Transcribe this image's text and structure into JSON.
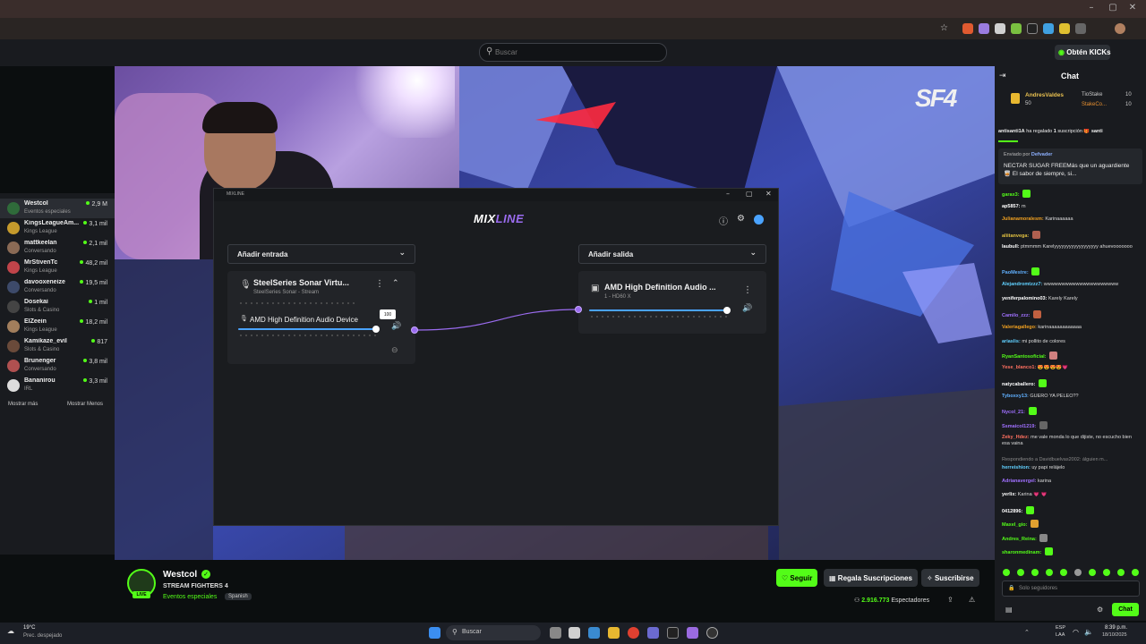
{
  "browser": {
    "window_controls": [
      "–",
      "▢",
      "✕"
    ]
  },
  "site_header": {
    "search_placeholder": "Buscar",
    "kicks_button_prefix": "Obtén",
    "kicks_button_brand": "KICKs"
  },
  "sidebar": {
    "items": [
      {
        "name": "Westcol",
        "category": "Eventos especiales",
        "viewers": "2,9 M",
        "color": "#2f6b3a"
      },
      {
        "name": "KingsLeagueAm...",
        "category": "Kings League",
        "viewers": "3,1 mil",
        "color": "#c59a2c"
      },
      {
        "name": "mattkeelan",
        "category": "Conversando",
        "viewers": "2,1 mil",
        "color": "#8a6a55"
      },
      {
        "name": "MrStivenTc",
        "category": "Kings League",
        "viewers": "48,2 mil",
        "color": "#c0444a"
      },
      {
        "name": "davooxeneize",
        "category": "Conversando",
        "viewers": "19,5 mil",
        "color": "#3d4a6a"
      },
      {
        "name": "Dosekai",
        "category": "Slots & Casino",
        "viewers": "1 mil",
        "color": "#444"
      },
      {
        "name": "ElZeein",
        "category": "Kings League",
        "viewers": "18,2 mil",
        "color": "#a27e5c"
      },
      {
        "name": "Kamikaze_evil",
        "category": "Slots & Casino",
        "viewers": "817",
        "color": "#6a4a3a"
      },
      {
        "name": "Brunenger",
        "category": "Conversando",
        "viewers": "3,8 mil",
        "color": "#b05050"
      },
      {
        "name": "Bananirou",
        "category": "IRL",
        "viewers": "3,3 mil",
        "color": "#dddddd"
      }
    ],
    "show_more": "Mostrar más",
    "show_less": "Mostrar Menos"
  },
  "video": {
    "overlay_logo": "SF4"
  },
  "mixline": {
    "title": "MIXLINE",
    "logo_mix": "MIX",
    "logo_line": "LINE",
    "add_input_label": "Añadir entrada",
    "add_output_label": "Añadir salida",
    "input_card": {
      "title": "SteelSeries Sonar Virtu...",
      "subtitle": "SteelSeries Sonar - Stream",
      "source_name": "AMD High Definition Audio Device",
      "tooltip_value": "100",
      "level": 1.0
    },
    "output_card": {
      "title": "AMD High Definition Audio ...",
      "subtitle": "1 - HD60 X",
      "level": 1.0
    },
    "accent": "#4aa3ff",
    "port_color": "#9b6cf0"
  },
  "chat": {
    "title": "Chat",
    "leaderboard": [
      {
        "name": "AndresValdes",
        "value": "50"
      },
      {
        "name": "TioStake",
        "value": "10"
      },
      {
        "name": "StakeCo...",
        "value": "10"
      }
    ],
    "gift_banner": {
      "user": "antisanti1A",
      "text": "ha regalado",
      "count": "1",
      "suffix": "suscripción",
      "tail": "santi"
    },
    "pinned": {
      "label": "Enviado por",
      "sender": "Defvader",
      "text": "NECTAR SUGAR FREEMás que un aguardiente 🥃 El sabor de siempre, si..."
    },
    "messages": [
      {
        "user": "garax3:",
        "text": "",
        "color": "#53fc18",
        "emote": "#53fc18"
      },
      {
        "user": "ap5857:",
        "text": "m",
        "color": "#ffffff"
      },
      {
        "user": "Julianamoralesm:",
        "text": "Karinaaaaaa",
        "color": "#f0a020"
      },
      {
        "user": "aliitanvega:",
        "text": "",
        "color": "#e0c040",
        "emote": "#b06050"
      },
      {
        "user": "laubull:",
        "text": "ptmmmm Karelyyyyyyyyyyyyyyyyyy ahuevooooooo",
        "color": "#ffffff"
      },
      {
        "user": "PaoMestre:",
        "text": "",
        "color": "#60b0ff",
        "emote": "#53fc18"
      },
      {
        "user": "Alejandromtzzz7:",
        "text": "wwwwwwwwwwwwwwwwwwwww",
        "color": "#60d0ff"
      },
      {
        "user": "yeniferpalomino03:",
        "text": "Karely Karely",
        "color": "#ffffff"
      },
      {
        "user": "Camilo_zzz:",
        "text": "",
        "color": "#a070ff",
        "emote": "#c06040"
      },
      {
        "user": "Valeriagallego:",
        "text": "karinaaaaaaaaaaaa",
        "color": "#f0a020"
      },
      {
        "user": "ariaslis:",
        "text": "mi pollito de colores",
        "color": "#60d0ff"
      },
      {
        "user": "RyanSantosoficial:",
        "text": "",
        "color": "#53fc18",
        "emote": "#d08080"
      },
      {
        "user": "Yese_blanco1:",
        "text": "😍😍😍😍💗",
        "color": "#ff7060"
      },
      {
        "user": "natycaballero:",
        "text": "",
        "color": "#ffffff",
        "emote": "#53fc18"
      },
      {
        "user": "Tyboxxy13:",
        "text": "GUERO YA PELEO??",
        "color": "#60b0ff"
      },
      {
        "user": "Nycol_21:",
        "text": "",
        "color": "#a070ff",
        "emote": "#53fc18"
      },
      {
        "user": "Ssmaicol1219:",
        "text": "",
        "color": "#a070ff",
        "emote": "#666666"
      },
      {
        "user": "Zeky_Hdez:",
        "text": "me vale monda lo que dijiste, no escucho bien esa vaina",
        "color": "#ff7060"
      },
      {
        "user": "",
        "text": "Respondiendo a Davidbuelvas2002: álguien m...",
        "color": "#888888"
      },
      {
        "user": "herreishion:",
        "text": "uy papi relájelo",
        "color": "#60d0ff"
      },
      {
        "user": "Adrianavergel:",
        "text": "karina",
        "color": "#a070ff"
      },
      {
        "user": "yerlix:",
        "text": "Karina 💗 💗",
        "color": "#ffffff"
      },
      {
        "user": "0412896:",
        "text": "",
        "color": "#ffffff",
        "emote": "#53fc18"
      },
      {
        "user": "Maxel_gio:",
        "text": "",
        "color": "#53fc18",
        "emote": "#e0a030"
      },
      {
        "user": "Andres_Reina:",
        "text": "",
        "color": "#53fc18",
        "emote": "#888888"
      },
      {
        "user": "sharonmedinam:",
        "text": "",
        "color": "#53fc18",
        "emote": "#53fc18"
      }
    ],
    "input_placeholder": "Solo seguidores",
    "send_label": "Chat"
  },
  "stream": {
    "channel": "Westcol",
    "title": "STREAM FIGHTERS 4",
    "category": "Eventos especiales",
    "language": "Spanish",
    "live_label": "LIVE",
    "follow_label": "Seguir",
    "gift_subs_label": "Regala Suscripciones",
    "subscribe_label": "Suscribirse",
    "viewers_count": "2.916.773",
    "viewers_label": "Espectadores"
  },
  "taskbar": {
    "weather_temp": "19°C",
    "weather_desc": "Prec. despejado",
    "search_label": "Buscar",
    "lang_top": "ESP",
    "lang_bottom": "LAA",
    "time": "8:39 p.m.",
    "date": "18/10/2025"
  }
}
